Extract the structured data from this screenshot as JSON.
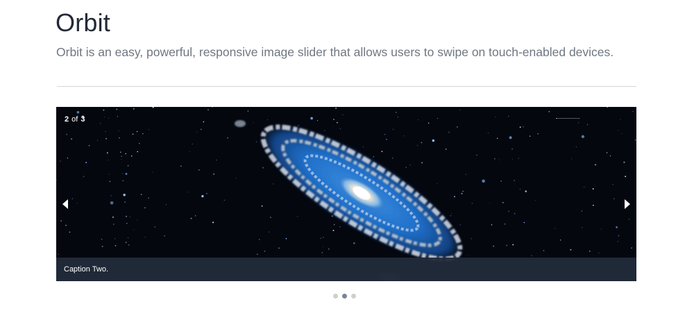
{
  "header": {
    "title": "Orbit",
    "subtitle": "Orbit is an easy, powerful, responsive image slider that allows users to swipe on touch-enabled devices."
  },
  "slider": {
    "current_slide": "2",
    "of_text": "of",
    "total_slides": "3",
    "caption": "Caption Two.",
    "image": "andromeda-galaxy-image",
    "prev_icon": "triangle-left-icon",
    "next_icon": "triangle-right-icon",
    "bullets": [
      {
        "active": false
      },
      {
        "active": true
      },
      {
        "active": false
      }
    ]
  },
  "colors": {
    "title": "#222a35",
    "subtitle": "#6f7782",
    "caption_bar": "#222b3a",
    "bullet_active": "#7a8594",
    "bullet_inactive": "#d2cfc8"
  }
}
